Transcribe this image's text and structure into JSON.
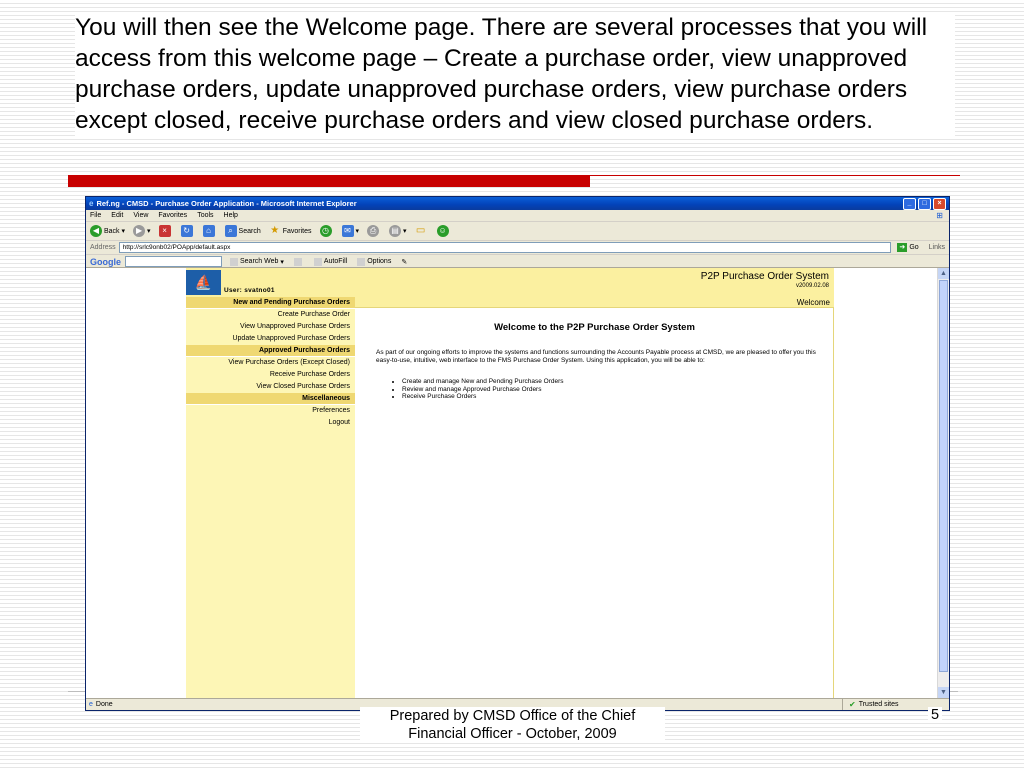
{
  "slide": {
    "text": "You will then see the Welcome page.  There are several processes that you will access from this welcome page – Create a purchase order, view unapproved purchase orders, update unapproved purchase orders, view purchase orders except closed, receive purchase orders and view closed purchase orders.",
    "footer": "Prepared by CMSD Office of the Chief Financial Officer - October, 2009",
    "page_number": "5"
  },
  "browser": {
    "window_title": "Ref.ng - CMSD - Purchase Order Application - Microsoft Internet Explorer",
    "menu": [
      "File",
      "Edit",
      "View",
      "Favorites",
      "Tools",
      "Help"
    ],
    "toolbar": {
      "back": "Back",
      "search": "Search",
      "favorites": "Favorites"
    },
    "address_label": "Address",
    "address": "http://srlc9onb02/POApp/default.aspx",
    "go_label": "Go",
    "links_label": "Links",
    "google": {
      "logo": "Google",
      "search_web": "Search Web",
      "autofill": "AutoFill",
      "options": "Options"
    },
    "status": {
      "left": "Done",
      "right": "Trusted sites"
    }
  },
  "app": {
    "user_label": "User: svatno01",
    "system_title": "P2P Purchase Order System",
    "version": "v2009.02.08",
    "welcome_bar": "Welcome",
    "sections": [
      {
        "title": "New and Pending Purchase Orders",
        "items": [
          "Create Purchase Order",
          "View Unapproved Purchase Orders",
          "Update Unapproved Purchase Orders"
        ]
      },
      {
        "title": "Approved Purchase Orders",
        "items": [
          "View Purchase Orders (Except Closed)",
          "Receive Purchase Orders",
          "View Closed Purchase Orders"
        ]
      },
      {
        "title": "Miscellaneous",
        "items": [
          "Preferences",
          "Logout"
        ]
      }
    ],
    "content_title": "Welcome to the P2P Purchase Order System",
    "content_para": "As part of our ongoing efforts to improve the systems and functions surrounding the Accounts Payable process at CMSD, we are pleased to offer you this easy-to-use, intuitive, web interface to the FMS Purchase Order System. Using this application, you will be able to:",
    "bullets": [
      "Create and manage New and Pending Purchase Orders",
      "Review and manage Approved Purchase Orders",
      "Receive Purchase Orders"
    ]
  }
}
